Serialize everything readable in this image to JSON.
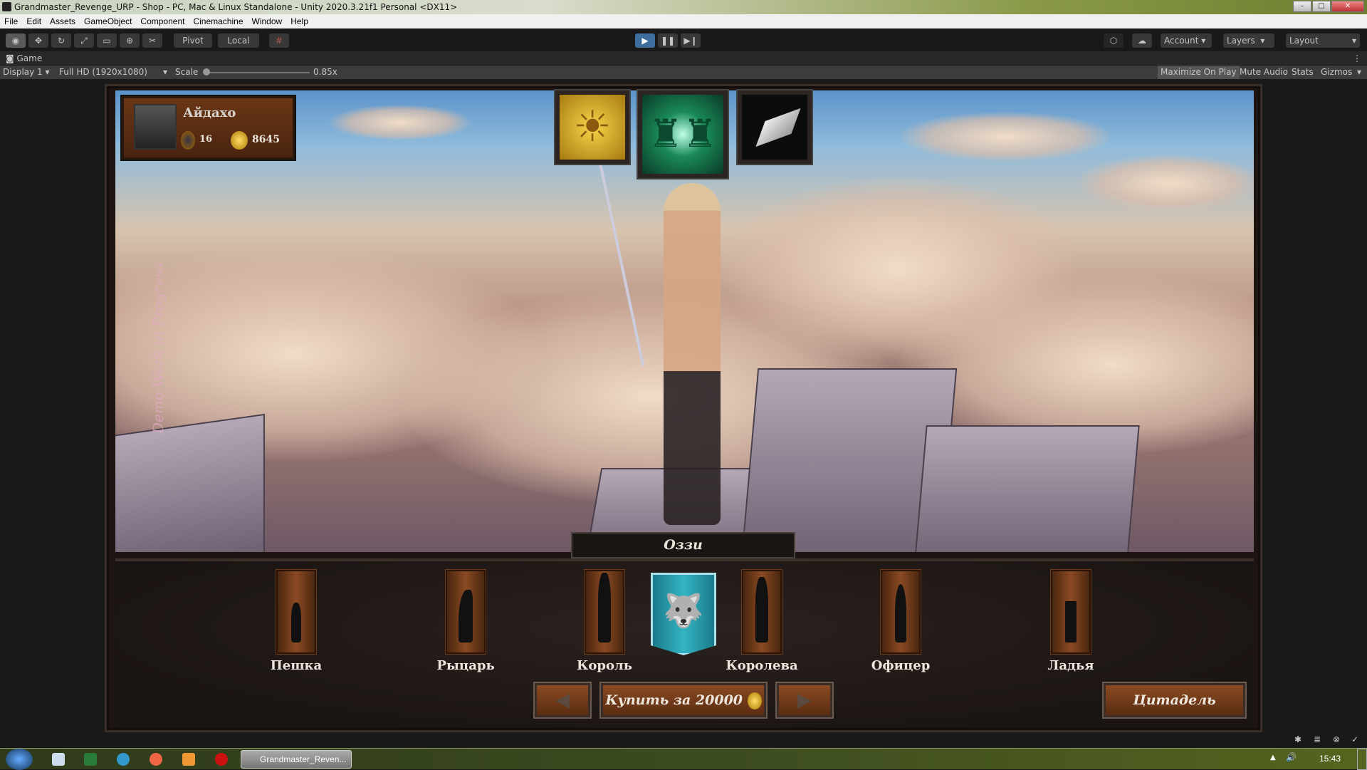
{
  "window": {
    "title": "Grandmaster_Revenge_URP - Shop - PC, Mac & Linux Standalone - Unity 2020.3.21f1 Personal <DX11>"
  },
  "menu": [
    "File",
    "Edit",
    "Assets",
    "GameObject",
    "Component",
    "Cinemachine",
    "Window",
    "Help"
  ],
  "toolbar": {
    "pivot": "Pivot",
    "local": "Local",
    "account": "Account",
    "layers": "Layers",
    "layout": "Layout"
  },
  "game_tab": {
    "label": "Game"
  },
  "game_bar": {
    "display": "Display 1",
    "resolution": "Full HD (1920x1080)",
    "scale_label": "Scale",
    "scale_value": "0.85x",
    "scale_fraction": 0.0,
    "maximize": "Maximize On Play",
    "mute": "Mute Audio",
    "stats": "Stats",
    "gizmos": "Gizmos"
  },
  "game": {
    "watermark": "Demo Work in Progress",
    "player": {
      "name": "Айдахо",
      "rank": "16",
      "gold": "8645"
    },
    "character_name": "Оззи",
    "pieces": [
      "Пешка",
      "Рыцарь",
      "Король",
      "Королева",
      "Офицер",
      "Ладья"
    ],
    "buy_label": "Купить за 20000",
    "citadel_label": "Цитадель",
    "colors": {
      "banner": "#2aa0b0",
      "wood": "#8a4a22"
    }
  },
  "taskbar": {
    "app_label": "Grandmaster_Reven...",
    "clock": "15:43"
  }
}
